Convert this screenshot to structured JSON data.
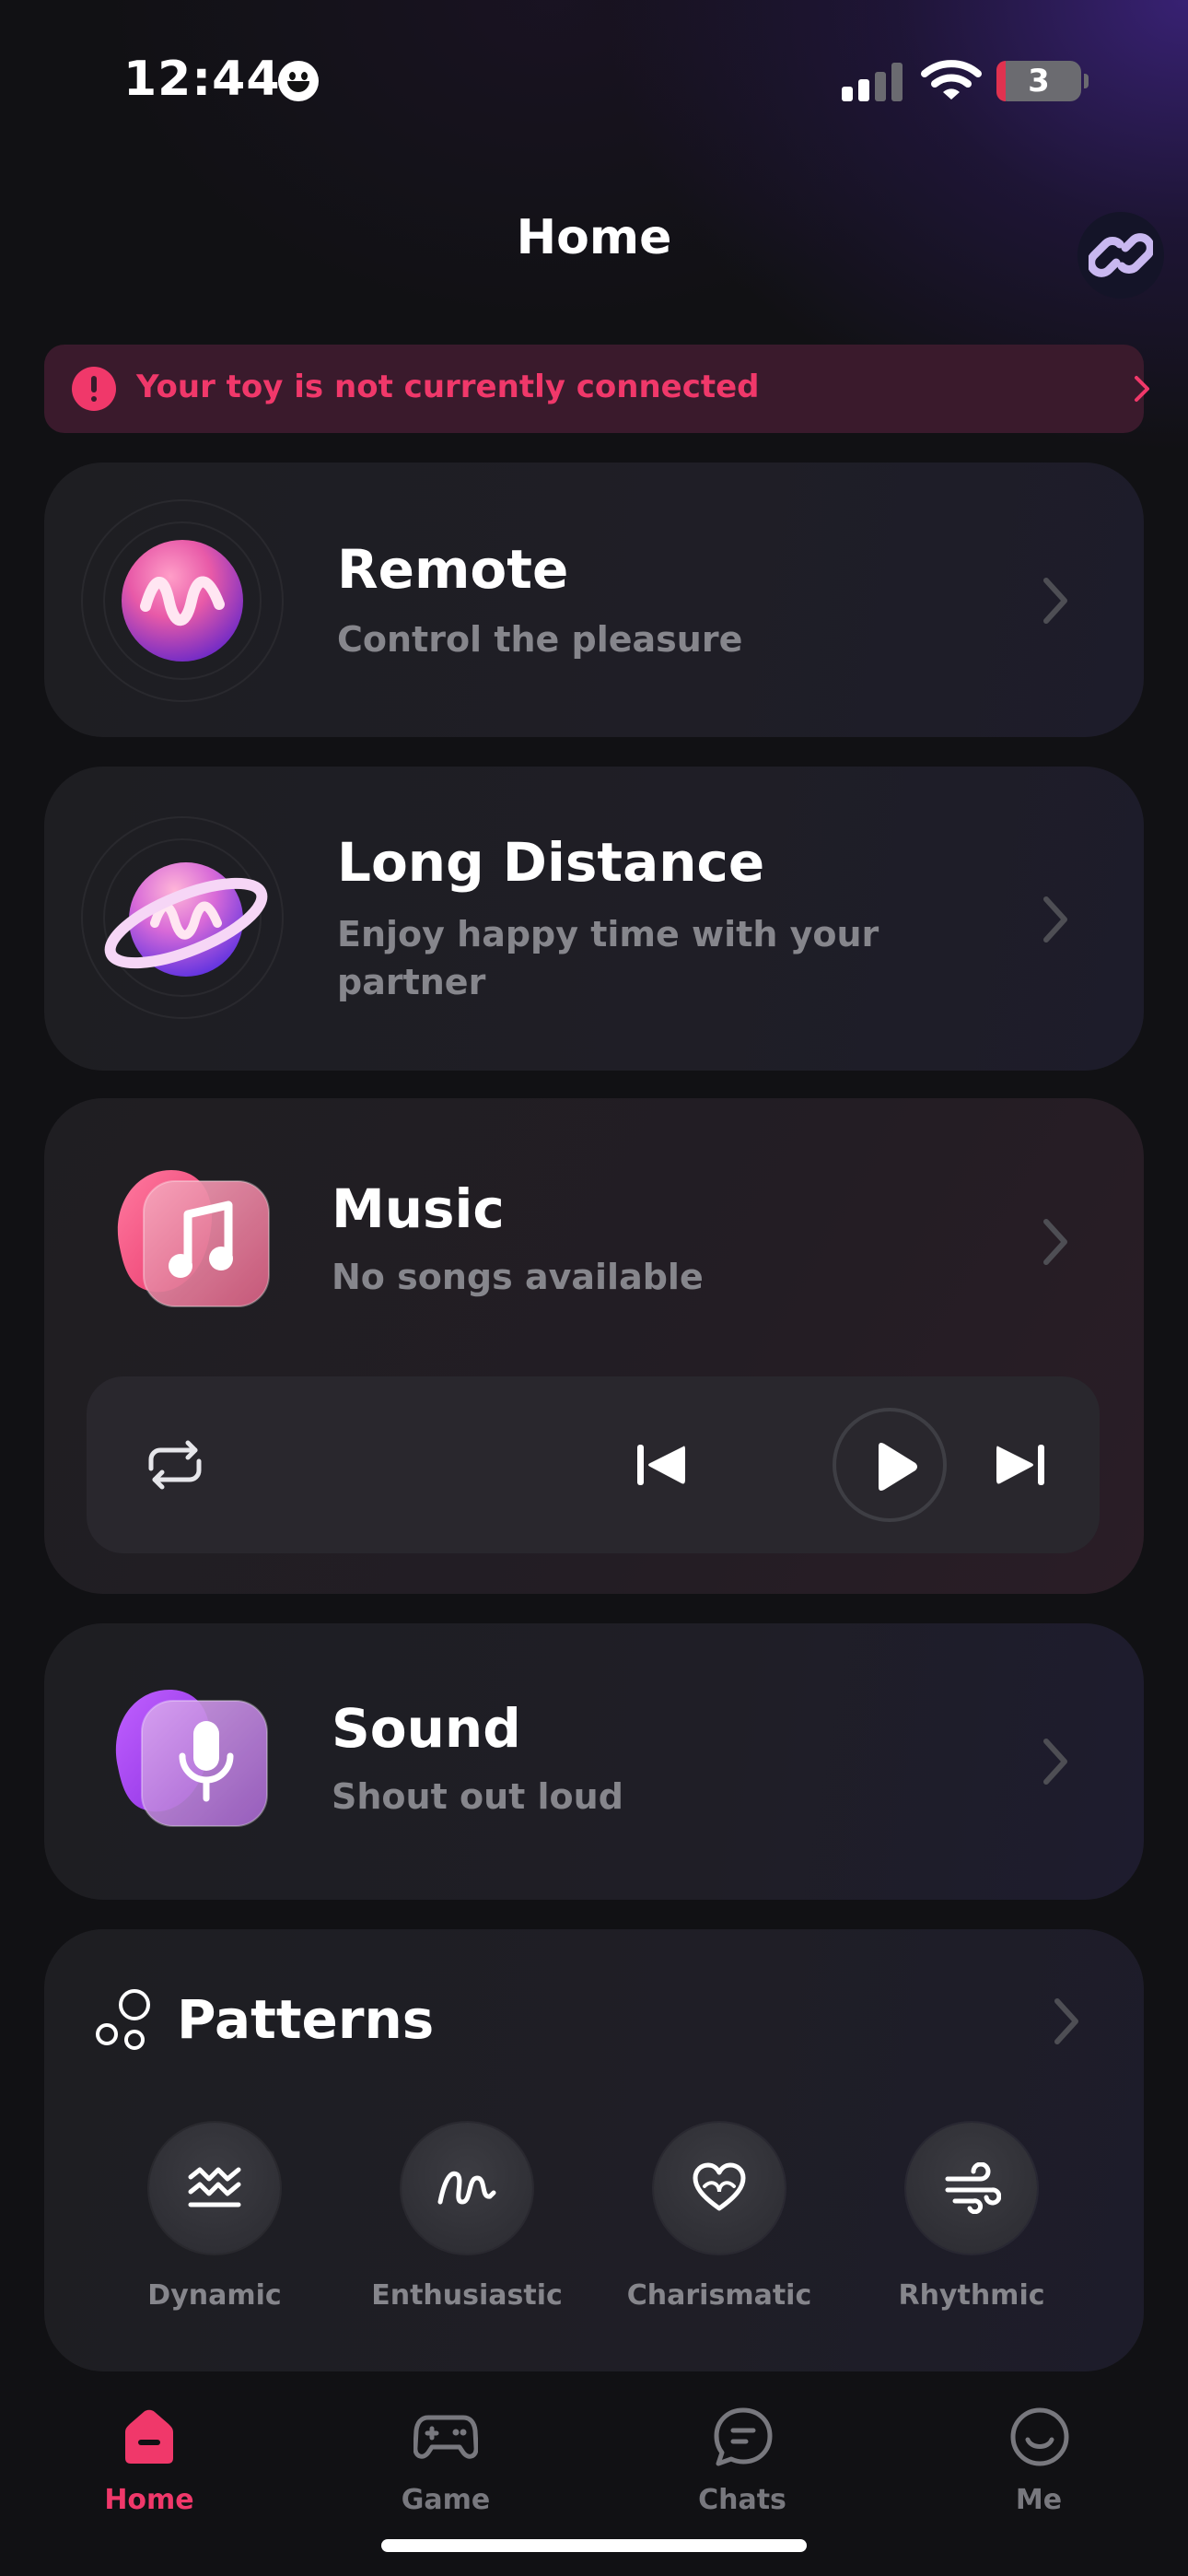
{
  "status_bar": {
    "time": "12:44",
    "battery": "3"
  },
  "header": {
    "title": "Home"
  },
  "alert": {
    "text": "Your toy is not currently connected"
  },
  "cards": {
    "remote": {
      "title": "Remote",
      "subtitle": "Control the pleasure"
    },
    "long_distance": {
      "title": "Long Distance",
      "subtitle_line1": "Enjoy happy time with your",
      "subtitle_line2": "partner"
    },
    "music": {
      "title": "Music",
      "subtitle": "No songs available"
    },
    "sound": {
      "title": "Sound",
      "subtitle": "Shout out loud"
    }
  },
  "patterns": {
    "title": "Patterns",
    "items": [
      {
        "label": "Dynamic",
        "icon": "wave-icon"
      },
      {
        "label": "Enthusiastic",
        "icon": "squiggle-icon"
      },
      {
        "label": "Charismatic",
        "icon": "heart-icon"
      },
      {
        "label": "Rhythmic",
        "icon": "wind-icon"
      }
    ]
  },
  "tab_bar": {
    "items": [
      {
        "label": "Home",
        "icon": "home-icon",
        "active": true
      },
      {
        "label": "Game",
        "icon": "gamepad-icon",
        "active": false
      },
      {
        "label": "Chats",
        "icon": "chat-icon",
        "active": false
      },
      {
        "label": "Me",
        "icon": "smile-icon",
        "active": false
      }
    ]
  },
  "colors": {
    "accent": "#f0386a",
    "background": "#111114",
    "card": "#1e1e22",
    "muted_text": "#86868c"
  }
}
